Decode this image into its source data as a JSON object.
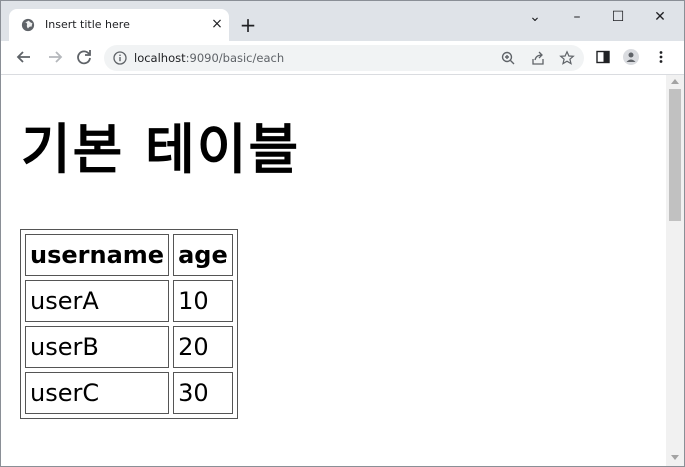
{
  "browser": {
    "tab": {
      "title": "Insert title here",
      "favicon": "globe-icon",
      "close_label": "×"
    },
    "new_tab_label": "+",
    "window_controls": {
      "dropdown": "⌄",
      "minimize": "–",
      "maximize": "☐",
      "close": "✕"
    },
    "address": {
      "host": "localhost",
      "rest": ":9090/basic/each"
    }
  },
  "page": {
    "title": "기본 테이블",
    "table": {
      "headers": [
        "username",
        "age"
      ],
      "rows": [
        [
          "userA",
          "10"
        ],
        [
          "userB",
          "20"
        ],
        [
          "userC",
          "30"
        ]
      ]
    }
  },
  "colors": {
    "tabstrip": "#dfe3e8",
    "omnibox": "#f1f3f4",
    "scroll_thumb": "#c1c1c1"
  }
}
